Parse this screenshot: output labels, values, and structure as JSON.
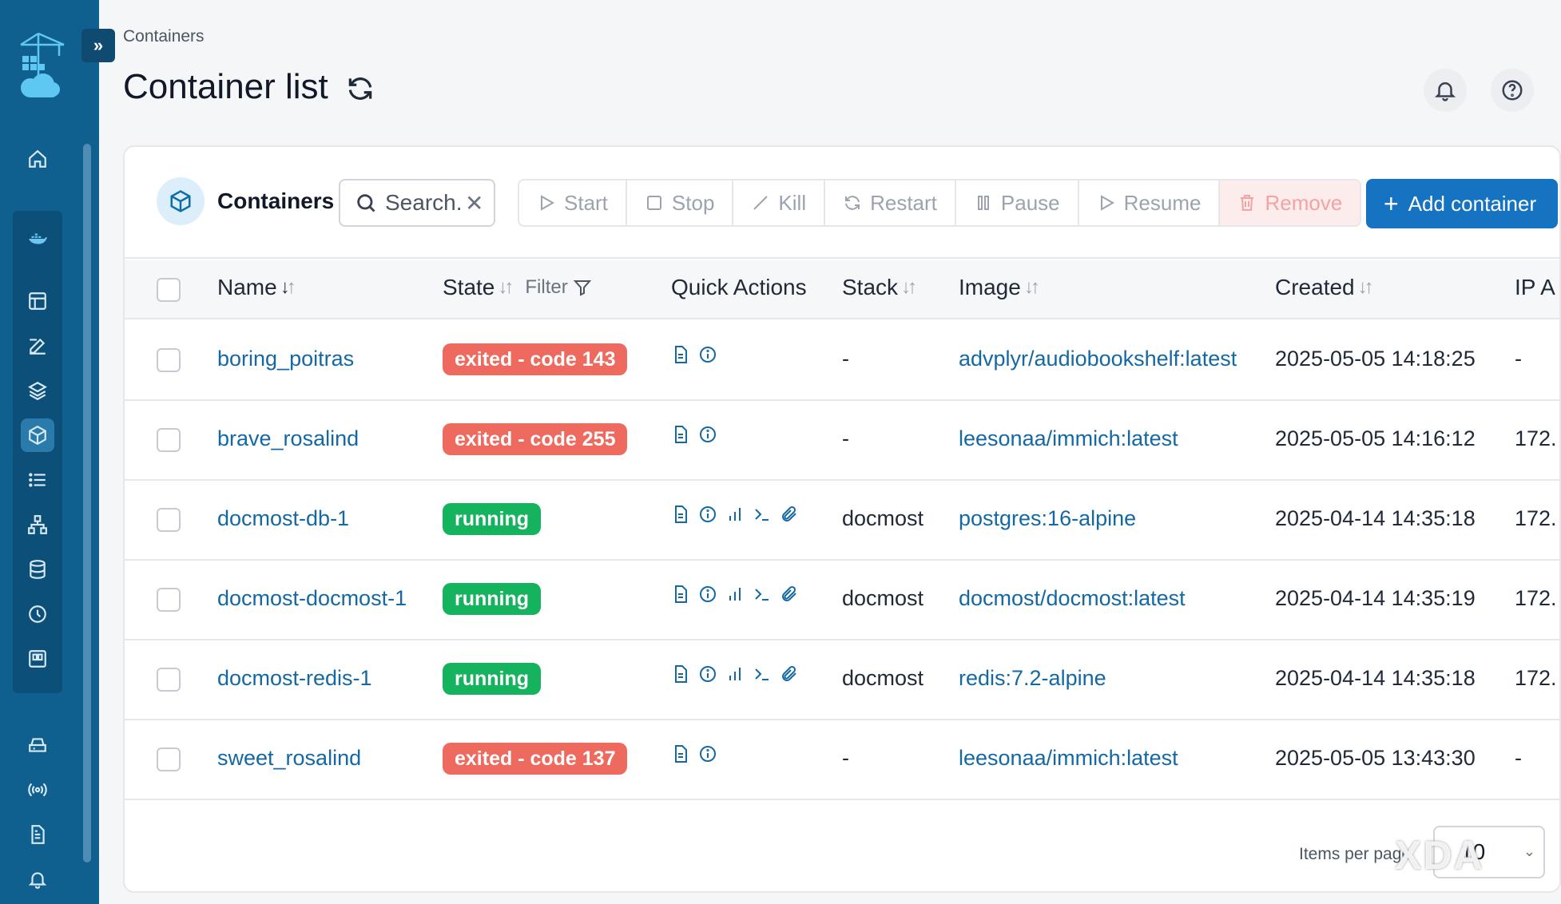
{
  "breadcrumb": "Containers",
  "page_title": "Container list",
  "card": {
    "title": "Containers",
    "search_placeholder": "Search..."
  },
  "toolbar": {
    "start": "Start",
    "stop": "Stop",
    "kill": "Kill",
    "restart": "Restart",
    "pause": "Pause",
    "resume": "Resume",
    "remove": "Remove",
    "add": "Add container"
  },
  "columns": {
    "name": "Name",
    "state": "State",
    "filter": "Filter",
    "quick_actions": "Quick Actions",
    "stack": "Stack",
    "image": "Image",
    "created": "Created",
    "ip": "IP A"
  },
  "rows": [
    {
      "name": "boring_poitras",
      "state": "exited - code 143",
      "stack": "-",
      "image": "advplyr/audiobookshelf:latest",
      "created": "2025-05-05 14:18:25",
      "ip": "-"
    },
    {
      "name": "brave_rosalind",
      "state": "exited - code 255",
      "stack": "-",
      "image": "leesonaa/immich:latest",
      "created": "2025-05-05 14:16:12",
      "ip": "172."
    },
    {
      "name": "docmost-db-1",
      "state": "running",
      "stack": "docmost",
      "image": "postgres:16-alpine",
      "created": "2025-04-14 14:35:18",
      "ip": "172."
    },
    {
      "name": "docmost-docmost-1",
      "state": "running",
      "stack": "docmost",
      "image": "docmost/docmost:latest",
      "created": "2025-04-14 14:35:19",
      "ip": "172."
    },
    {
      "name": "docmost-redis-1",
      "state": "running",
      "stack": "docmost",
      "image": "redis:7.2-alpine",
      "created": "2025-04-14 14:35:18",
      "ip": "172."
    },
    {
      "name": "sweet_rosalind",
      "state": "exited - code 137",
      "stack": "-",
      "image": "leesonaa/immich:latest",
      "created": "2025-05-05 13:43:30",
      "ip": "-"
    }
  ],
  "pagination": {
    "items_per_page_label": "Items per page",
    "items_per_page": "10"
  },
  "watermark": "XDA",
  "colors": {
    "sidebar": "#0f5f8f",
    "primary": "#1573c2",
    "link": "#1468a3",
    "exited": "#ee6a5e",
    "running": "#15b35e"
  }
}
